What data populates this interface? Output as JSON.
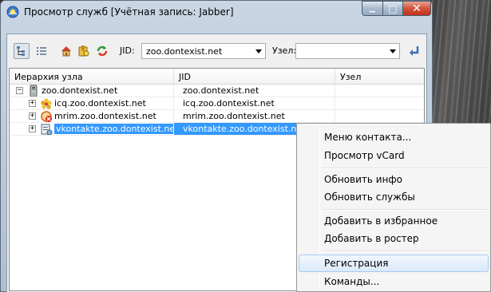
{
  "window": {
    "title": "Просмотр служб [Учётная запись: Jabber]",
    "minimize_glyph": "▁",
    "maximize_glyph": "□",
    "close_glyph": "✕"
  },
  "toolbar": {
    "jid_label": "JID:",
    "jid_value": "zoo.dontexist.net",
    "node_label": "Узел:",
    "node_value": "",
    "icons": [
      "tree-view-icon",
      "list-view-icon",
      "home-icon",
      "bookmark-icon",
      "refresh-icon",
      "go-icon"
    ]
  },
  "table": {
    "headers": [
      "Иерархия узла",
      "JID",
      "Узел"
    ],
    "rows": [
      {
        "name": "zoo.dontexist.net",
        "jid": "zoo.dontexist.net",
        "node": "",
        "expander": "−",
        "icon": "server-icon"
      },
      {
        "name": "icq.zoo.dontexist.net",
        "jid": "icq.zoo.dontexist.net",
        "node": "",
        "expander": "+",
        "icon": "icq-flower-icon"
      },
      {
        "name": "mrim.zoo.dontexist.net",
        "jid": "mrim.zoo.dontexist.net",
        "node": "",
        "expander": "+",
        "icon": "mrim-icon"
      },
      {
        "name": "vkontakte.zoo.dontexist.net",
        "jid": "vkontakte.zoo.dontexist.net",
        "node": "",
        "expander": "+",
        "icon": "transport-icon",
        "selected": true
      }
    ]
  },
  "context_menu": {
    "items": [
      {
        "label": "Меню контакта..."
      },
      {
        "label": "Просмотр vCard"
      },
      {
        "label": "Обновить инфо"
      },
      {
        "label": "Обновить службы"
      },
      {
        "label": "Добавить в избранное"
      },
      {
        "label": "Добавить в ростер"
      },
      {
        "label": "Регистрация",
        "highlighted": true
      },
      {
        "label": "Команды..."
      }
    ]
  },
  "colors": {
    "selection": "#3399ff",
    "menu_highlight_border": "#a8cbf1"
  }
}
